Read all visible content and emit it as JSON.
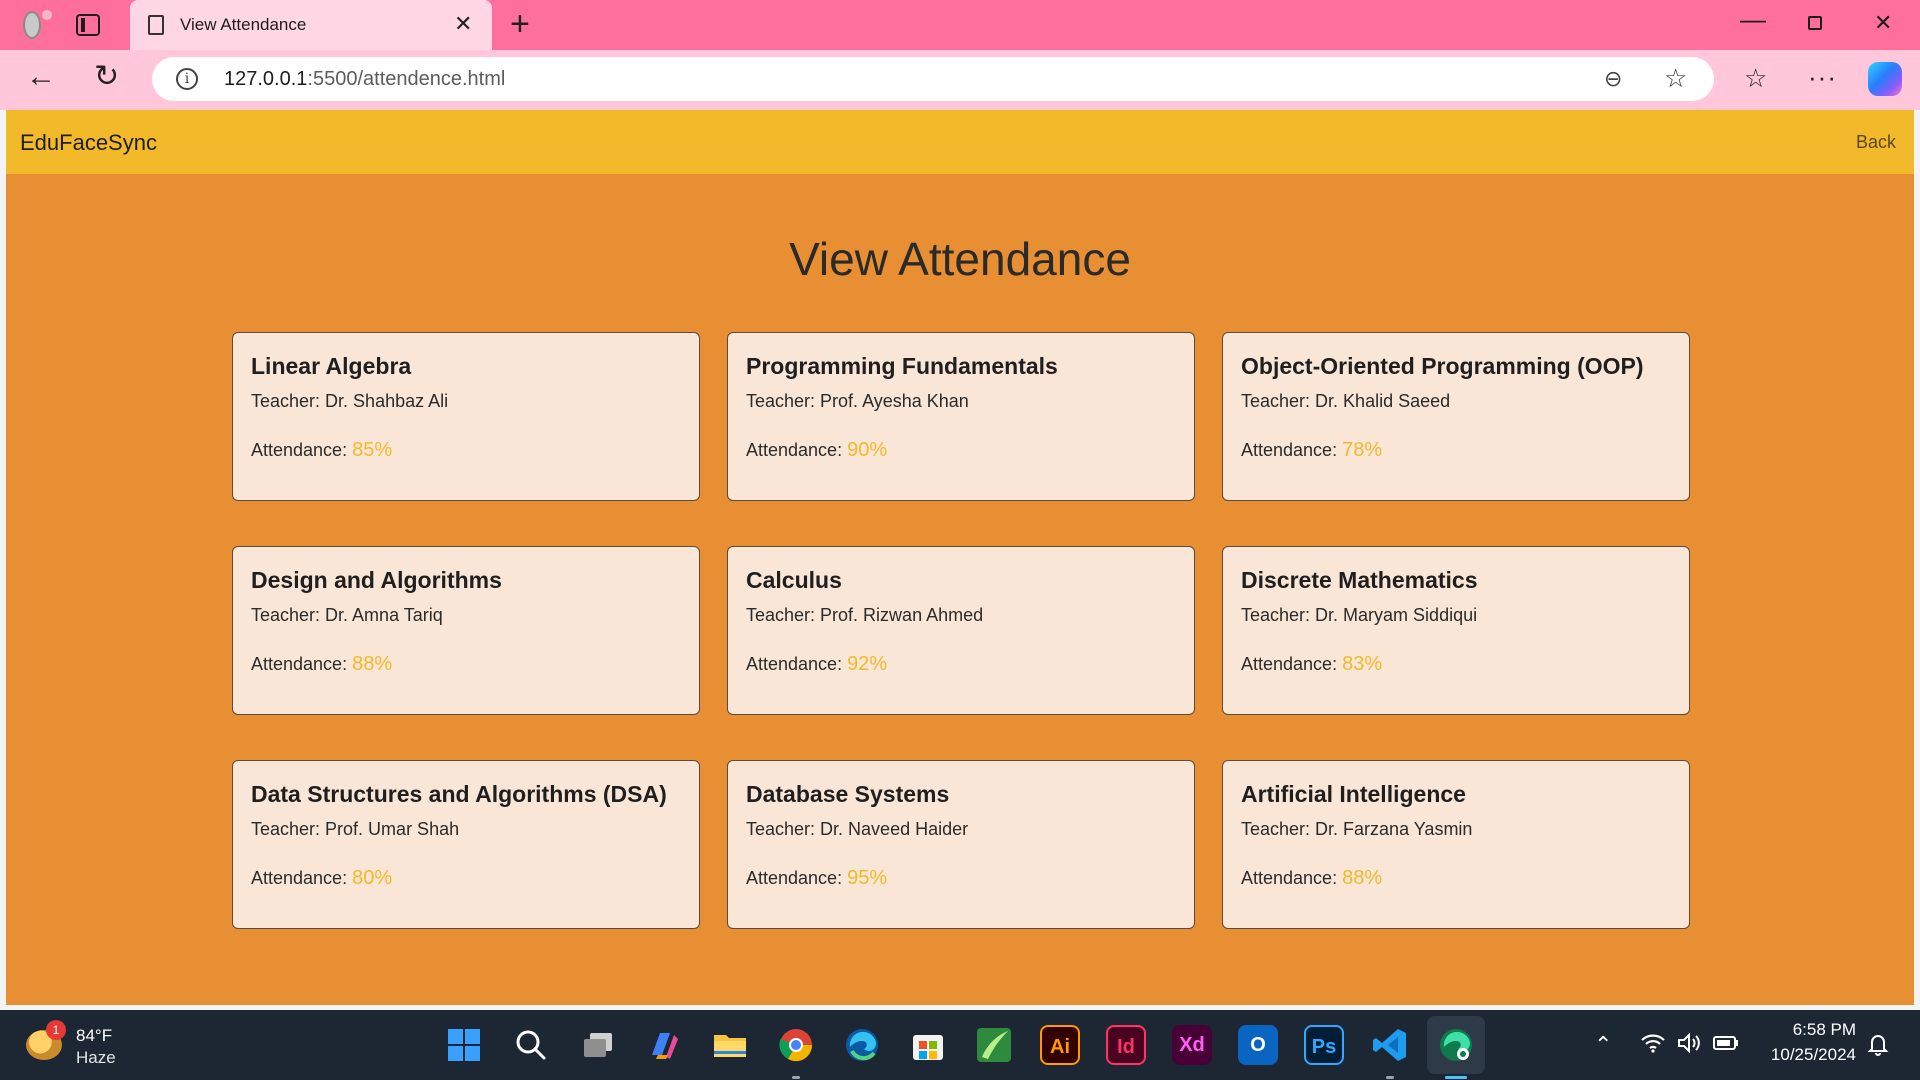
{
  "browser": {
    "tab_title": "View Attendance",
    "url_host": "127.0.0.1",
    "url_rest": ":5500/attendence.html"
  },
  "navbar": {
    "brand": "EduFaceSync",
    "back_label": "Back"
  },
  "page": {
    "title": "View Attendance"
  },
  "labels": {
    "teacher_prefix": "Teacher: ",
    "attendance_prefix": "Attendance: "
  },
  "courses": [
    {
      "title": "Linear Algebra",
      "teacher": "Dr. Shahbaz Ali",
      "attendance": "85%"
    },
    {
      "title": "Programming Fundamentals",
      "teacher": "Prof. Ayesha Khan",
      "attendance": "90%"
    },
    {
      "title": "Object-Oriented Programming (OOP)",
      "teacher": "Dr. Khalid Saeed",
      "attendance": "78%"
    },
    {
      "title": "Design and Algorithms",
      "teacher": "Dr. Amna Tariq",
      "attendance": "88%"
    },
    {
      "title": "Calculus",
      "teacher": "Prof. Rizwan Ahmed",
      "attendance": "92%"
    },
    {
      "title": "Discrete Mathematics",
      "teacher": "Dr. Maryam Siddiqui",
      "attendance": "83%"
    },
    {
      "title": "Data Structures and Algorithms (DSA)",
      "teacher": "Prof. Umar Shah",
      "attendance": "80%"
    },
    {
      "title": "Database Systems",
      "teacher": "Dr. Naveed Haider",
      "attendance": "95%"
    },
    {
      "title": "Artificial Intelligence",
      "teacher": "Dr. Farzana Yasmin",
      "attendance": "88%"
    }
  ],
  "taskbar": {
    "weather_temp": "84°F",
    "weather_condition": "Haze",
    "weather_badge": "1",
    "clock_time": "6:58 PM",
    "clock_date": "10/25/2024",
    "apps": [
      {
        "name": "start-icon",
        "label": ""
      },
      {
        "name": "search-icon",
        "label": ""
      },
      {
        "name": "task-view-icon",
        "label": ""
      },
      {
        "name": "copilot-icon",
        "label": ""
      },
      {
        "name": "file-explorer-icon",
        "label": ""
      },
      {
        "name": "chrome-icon",
        "label": ""
      },
      {
        "name": "edge-icon",
        "label": ""
      },
      {
        "name": "store-icon",
        "label": ""
      },
      {
        "name": "coreldraw-icon",
        "label": ""
      },
      {
        "name": "illustrator-icon",
        "label": "Ai"
      },
      {
        "name": "indesign-icon",
        "label": "Id"
      },
      {
        "name": "xd-icon",
        "label": "Xd"
      },
      {
        "name": "outlook-icon",
        "label": "O"
      },
      {
        "name": "photoshop-icon",
        "label": "Ps"
      },
      {
        "name": "vscode-icon",
        "label": ""
      },
      {
        "name": "edge-dev-icon",
        "label": ""
      }
    ]
  },
  "colors": {
    "tabbar": "#ff6f9e",
    "addressbar": "#ffc7d9",
    "navbar": "#f2b92b",
    "page_bg": "#e88f33",
    "card_bg": "#fae6d6",
    "attendance_value": "#f2b92b"
  }
}
